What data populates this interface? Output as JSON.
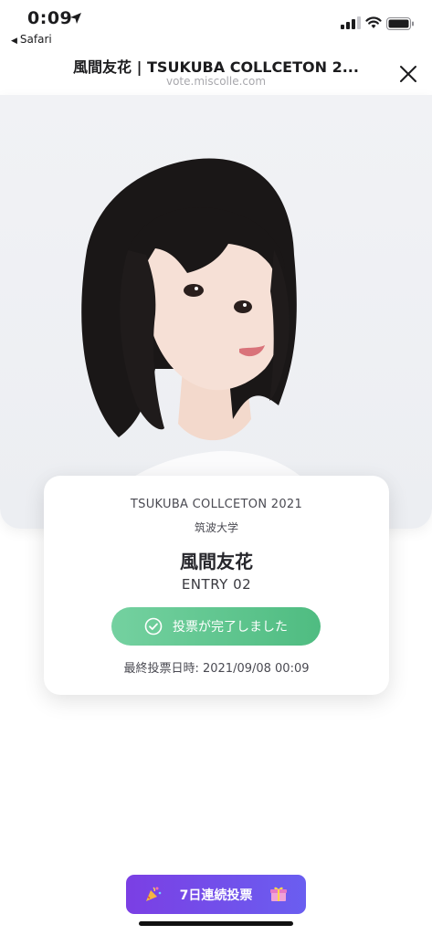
{
  "status_bar": {
    "time": "0:09",
    "back_app": "Safari",
    "icons": [
      "location-arrow-icon",
      "signal-icon",
      "wifi-icon",
      "battery-icon"
    ]
  },
  "nav": {
    "title": "風間友花 | TSUKUBA COLLCETON 2...",
    "url": "vote.miscolle.com",
    "close_icon": "close-icon"
  },
  "card": {
    "event": "TSUKUBA COLLCETON 2021",
    "university": "筑波大学",
    "name": "風間友花",
    "entry": "ENTRY 02",
    "vote_status": "投票が完了しました",
    "last_vote": "最終投票日時: 2021/09/08 00:09"
  },
  "bottom": {
    "streak_label": "7日連続投票",
    "left_icon": "party-popper-icon",
    "right_icon": "gift-icon"
  },
  "colors": {
    "vote_green": "#5cc48c",
    "streak_purple": "#7248e8",
    "hero_bg": "#eef0f3"
  }
}
